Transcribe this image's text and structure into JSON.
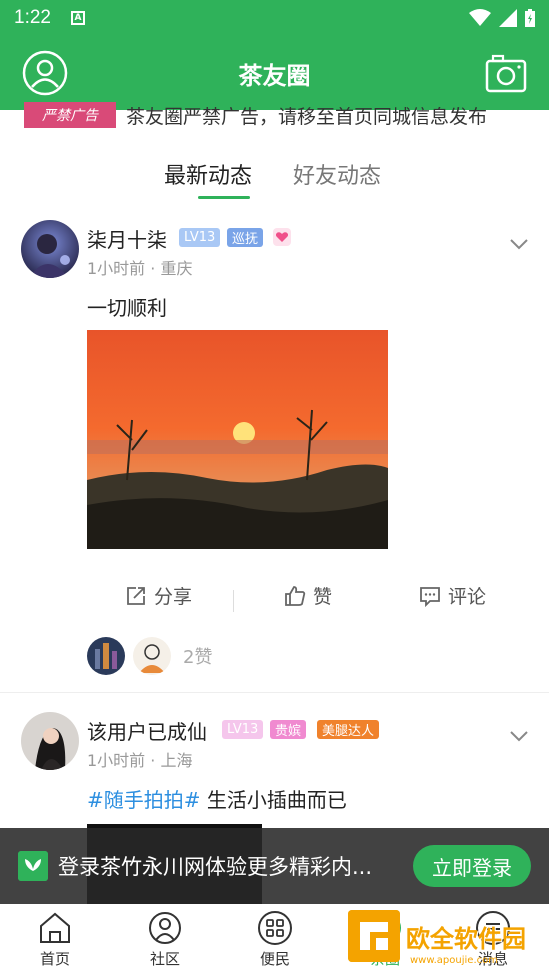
{
  "status_bar": {
    "time": "1:22",
    "sim_label": "A"
  },
  "app_bar": {
    "title": "茶友圈",
    "left_icon": "user-avatar-icon",
    "right_icon": "camera-icon"
  },
  "banner": {
    "tag": "严禁广告",
    "text": "茶友圈严禁广告，请移至首页同城信息发布"
  },
  "tabs": [
    {
      "label": "最新动态",
      "active": true
    },
    {
      "label": "好友动态",
      "active": false
    }
  ],
  "posts": [
    {
      "user_name": "柒月十柒",
      "badges": [
        "LV13",
        "巡抚"
      ],
      "meta": "1小时前 · 重庆",
      "content": "一切顺利",
      "actions": {
        "share": "分享",
        "like": "赞",
        "comment": "评论"
      },
      "likes_text": "2赞"
    },
    {
      "user_name": "该用户已成仙",
      "badges": [
        "LV13",
        "贵嫔",
        "美腿达人"
      ],
      "meta": "1小时前 · 上海",
      "hashtag": "#随手拍拍#",
      "content": " 生活小插曲而已"
    }
  ],
  "login_prompt": {
    "message": "登录茶竹永川网体验更多精彩内...",
    "button": "立即登录"
  },
  "bottom_nav": [
    {
      "label": "首页",
      "icon": "home-icon"
    },
    {
      "label": "社区",
      "icon": "community-icon"
    },
    {
      "label": "便民",
      "icon": "grid-icon"
    },
    {
      "label": "茶圈",
      "icon": "tea-circle-icon"
    },
    {
      "label": "消息",
      "icon": "message-icon"
    }
  ],
  "watermark": {
    "text": "欧全软件园",
    "url": "www.apoujie.com"
  },
  "colors": {
    "brand_green": "#2fb25a",
    "hashtag_blue": "#2d8fe0",
    "badge_lv": "#a9c8f5",
    "badge_xunfu": "#7aa4e8",
    "badge_guipin": "#f08ad0",
    "badge_meitui": "#f0822c"
  }
}
